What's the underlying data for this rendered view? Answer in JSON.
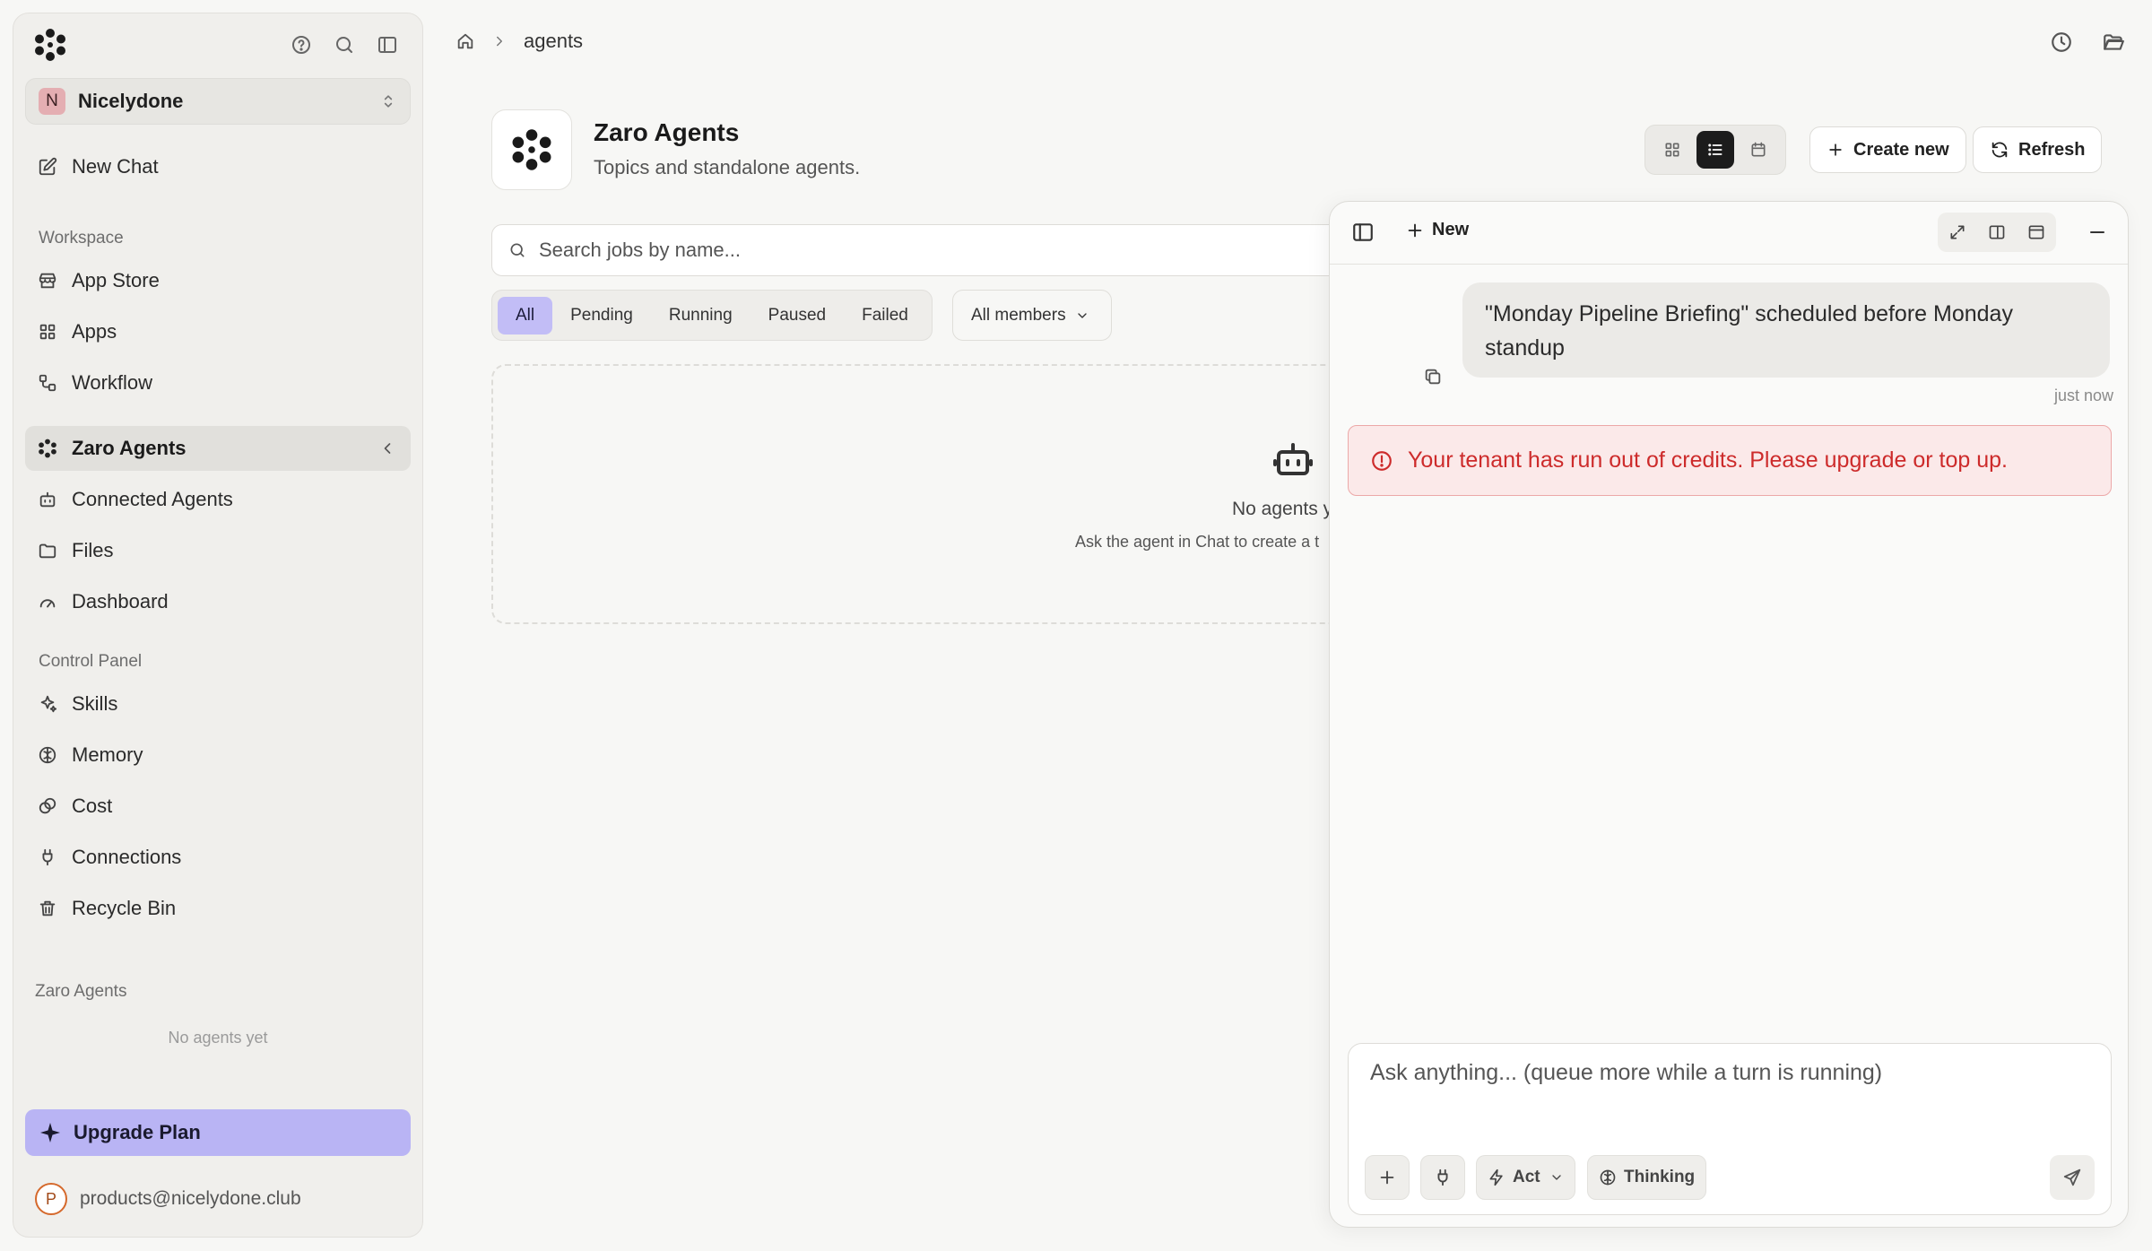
{
  "sidebar": {
    "workspace": {
      "initial": "N",
      "name": "Nicelydone"
    },
    "new_chat": "New Chat",
    "workspace_label": "Workspace",
    "workspace_items": [
      {
        "label": "App Store",
        "icon": "store-icon"
      },
      {
        "label": "Apps",
        "icon": "grid-icon"
      },
      {
        "label": "Workflow",
        "icon": "workflow-icon"
      },
      {
        "label": "Zaro Agents",
        "icon": "flower-icon",
        "active": true
      },
      {
        "label": "Connected Agents",
        "icon": "bot-icon"
      },
      {
        "label": "Files",
        "icon": "folder-icon"
      },
      {
        "label": "Dashboard",
        "icon": "gauge-icon"
      }
    ],
    "control_panel_label": "Control Panel",
    "control_items": [
      {
        "label": "Skills",
        "icon": "sparkle-icon"
      },
      {
        "label": "Memory",
        "icon": "brain-icon"
      },
      {
        "label": "Cost",
        "icon": "coins-icon"
      },
      {
        "label": "Connections",
        "icon": "plug-icon"
      },
      {
        "label": "Recycle Bin",
        "icon": "trash-icon"
      }
    ],
    "agents_label": "Zaro Agents",
    "agents_empty": "No agents yet",
    "upgrade": "Upgrade Plan",
    "user": {
      "initial": "P",
      "email": "products@nicelydone.club"
    }
  },
  "breadcrumb": {
    "current": "agents"
  },
  "page": {
    "title": "Zaro Agents",
    "subtitle": "Topics and standalone agents.",
    "create_new": "Create new",
    "refresh": "Refresh",
    "search_placeholder": "Search jobs by name...",
    "filters": [
      "All",
      "Pending",
      "Running",
      "Paused",
      "Failed"
    ],
    "active_filter": "All",
    "members_filter": "All members",
    "empty_title": "No agents y",
    "empty_hint": "Ask the agent in Chat to create a t"
  },
  "chat": {
    "new_label": "New",
    "user_message": "\"Monday Pipeline Briefing\" scheduled before Monday standup",
    "message_time": "just now",
    "error": "Your tenant has run out of credits. Please upgrade or top up.",
    "input_placeholder": "Ask anything... (queue more while a turn is running)",
    "mode": "Act",
    "thinking": "Thinking"
  },
  "colors": {
    "accent": "#b9b4f4",
    "error": "#cd2b2b",
    "error_bg": "#fbe9e9"
  }
}
